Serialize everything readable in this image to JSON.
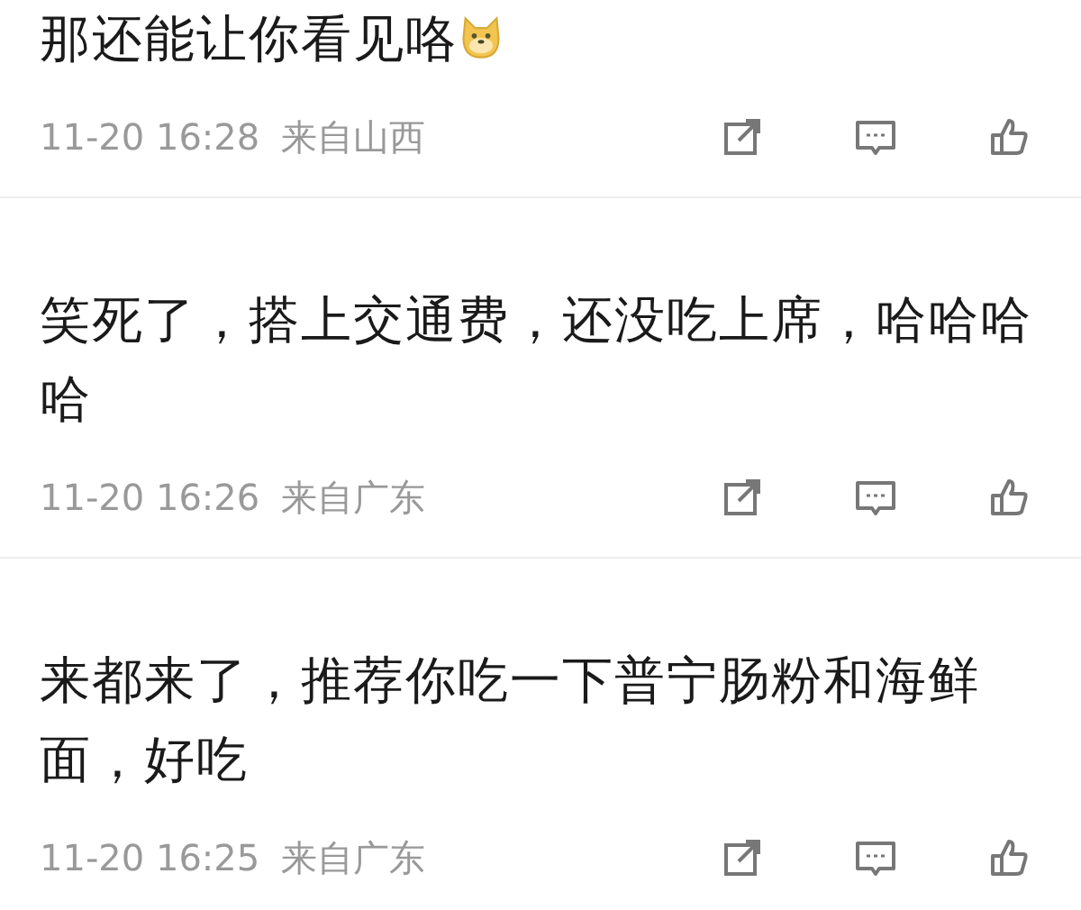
{
  "comments": [
    {
      "text": "那还能让你看见咯",
      "trailing_emoji": true,
      "time": "11-20 16:28",
      "location": "来自山西"
    },
    {
      "text": "笑死了，搭上交通费，还没吃上席，哈哈哈哈",
      "trailing_emoji": false,
      "time": "11-20 16:26",
      "location": "来自广东"
    },
    {
      "text": "来都来了，推荐你吃一下普宁肠粉和海鲜面，好吃",
      "trailing_emoji": false,
      "time": "11-20 16:25",
      "location": "来自广东"
    }
  ]
}
